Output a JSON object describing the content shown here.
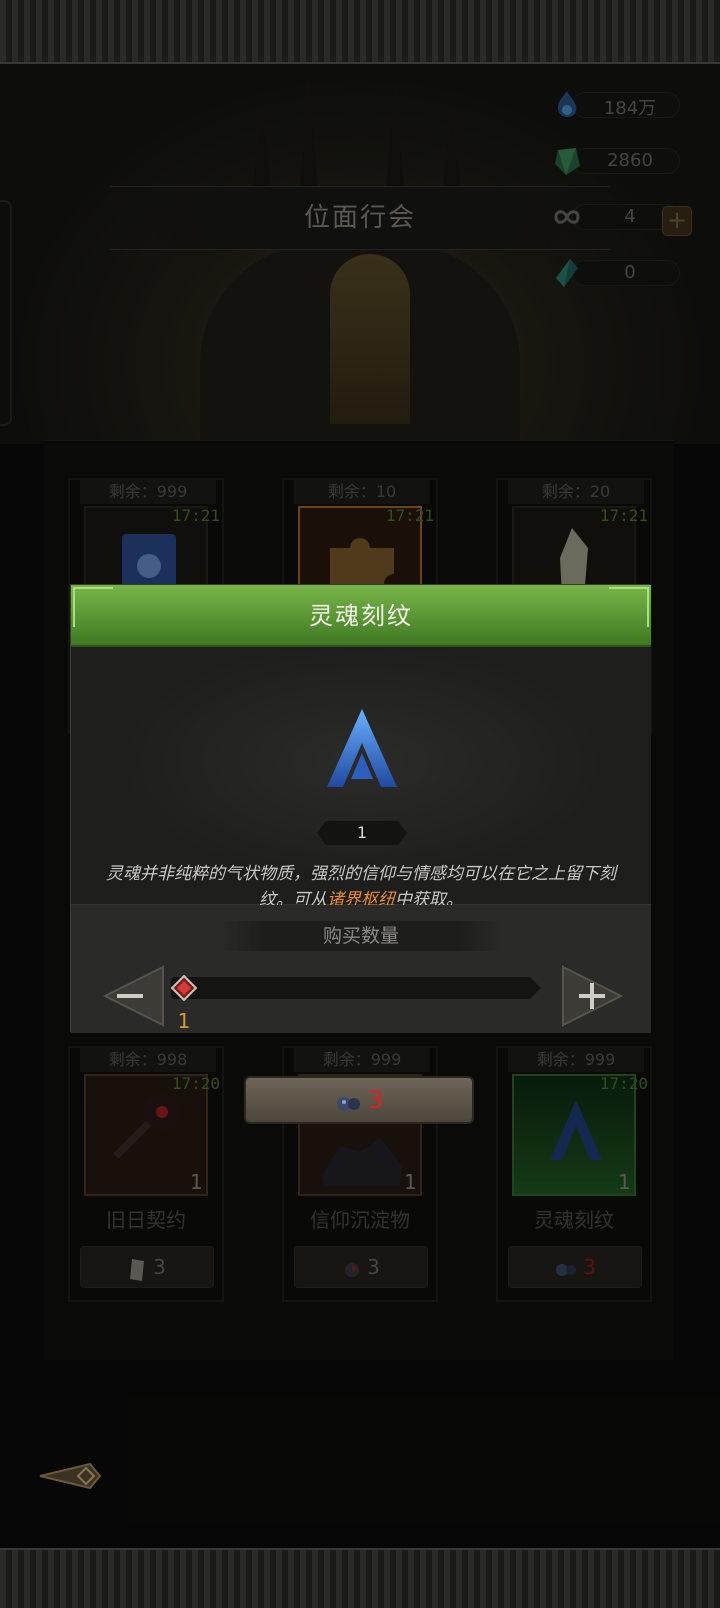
{
  "header": {
    "title": "位面行会"
  },
  "currencies": [
    {
      "name": "blue-soul-icon",
      "value": "184万"
    },
    {
      "name": "green-crystal-icon",
      "value": "2860"
    },
    {
      "name": "infinity-chain-icon",
      "value": "4"
    },
    {
      "name": "teal-shard-icon",
      "value": "0"
    }
  ],
  "shop_top": [
    {
      "remain": "剩余：999",
      "timer": "17:21"
    },
    {
      "remain": "剩余：10",
      "timer": "17:21"
    },
    {
      "remain": "剩余：20",
      "timer": "17:21"
    }
  ],
  "shop_bottom": [
    {
      "remain": "剩余：998",
      "timer": "17:20",
      "qty": "1",
      "name": "旧日契约",
      "price": "3"
    },
    {
      "remain": "剩余：999",
      "timer": "",
      "qty": "1",
      "name": "信仰沉淀物",
      "price": "3"
    },
    {
      "remain": "剩余：999",
      "timer": "17:20",
      "qty": "1",
      "name": "灵魂刻纹",
      "price": "3"
    }
  ],
  "dialog": {
    "title": "灵魂刻纹",
    "count": "1",
    "desc_part1": "灵魂并非纯粹的气状物质，强烈的信仰与情感均可以在它之上留下刻纹。可从",
    "desc_highlight": "诸界枢纽",
    "desc_part2": "中获取。",
    "buy_label": "购买数量",
    "slider_value": "1",
    "buy_price": "3"
  },
  "colors": {
    "accent_green": "#78b549",
    "highlight_orange": "#e58a3a",
    "price_red": "#e02020",
    "slider_value": "#d4a028"
  }
}
